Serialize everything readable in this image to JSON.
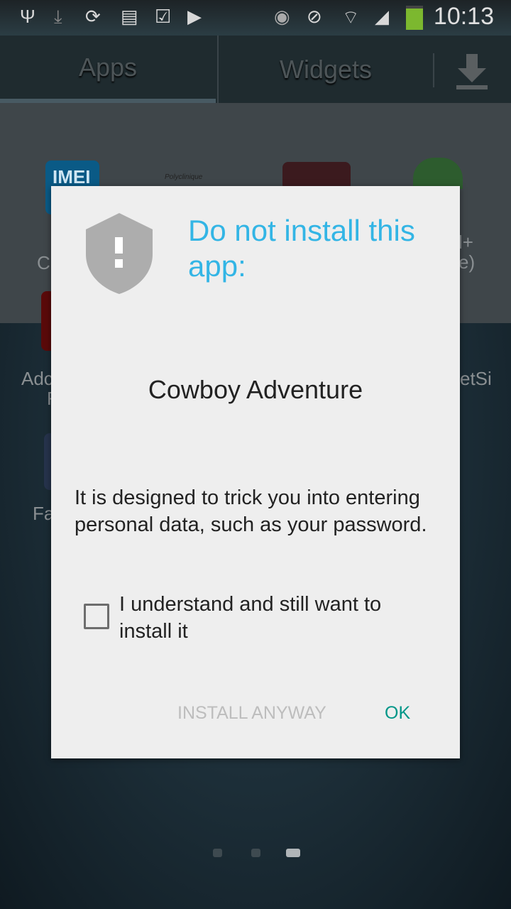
{
  "status_bar": {
    "icons": [
      "usb-icon",
      "download-icon",
      "sync-icon",
      "sim-error-icon",
      "shopping-bag-check-icon",
      "play-store-icon",
      "eye-icon",
      "vibrate-mute-icon",
      "wifi-icon",
      "signal-icon",
      "battery-charging-icon"
    ],
    "time": "10:13",
    "battery_color": "#7cb82f"
  },
  "tabs": [
    {
      "label": "Apps",
      "active": true
    },
    {
      "label": "Widgets",
      "active": false
    }
  ],
  "background_apps": {
    "imei_icon_text": "IMEI",
    "polyclinique_text": "Polyclinique",
    "labels": [
      "C",
      "Adc",
      "F",
      "Fa",
      "l+",
      "e)",
      "etSi"
    ]
  },
  "dialog": {
    "icon": "shield-alert-icon",
    "title": "Do not install this app:",
    "app_name": "Cowboy Adventure",
    "message": "It is designed to trick you into entering personal data, such as your password.",
    "checkbox_label": "I understand and still want to install it",
    "checkbox_checked": false,
    "install_button": "INSTALL ANYWAY",
    "ok_button": "OK",
    "title_color": "#33b5e5",
    "ok_color": "#009688"
  },
  "page_indicator": {
    "count": 3,
    "active_index": 2
  }
}
